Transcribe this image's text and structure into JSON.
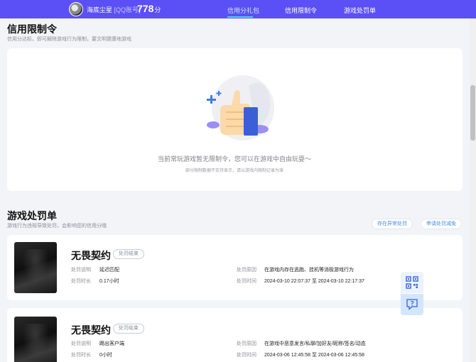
{
  "header": {
    "nickname": "海底尘星",
    "account_type": "[QQ账号]",
    "score_value": "778",
    "score_unit": "分",
    "nav": [
      {
        "label": "信用分礼包",
        "active": true
      },
      {
        "label": "信用限制令",
        "active": false
      },
      {
        "label": "游戏处罚单",
        "active": false
      }
    ]
  },
  "restriction": {
    "title": "信用限制令",
    "subtitle": "信用分达标，即可解除游戏行为限制，要文明健康地游戏",
    "empty_message": "当前常玩游戏暂无限制令，您可以在游戏中自由玩耍～",
    "empty_note": "部分限制数据不支持显示，请以游戏内限制记录为准"
  },
  "punishment": {
    "title": "游戏处罚单",
    "subtitle": "游戏行为违规导致处罚，会影响您的信用分哦",
    "buttons": [
      "存在异常处罚",
      "申请处罚减免"
    ],
    "labels": {
      "explain": "处罚说明",
      "duration": "处罚时长",
      "reason": "处罚原因",
      "time": "处罚时间"
    },
    "items": [
      {
        "game": "无畏契约",
        "status": "处罚结束",
        "explain": "延迟匹配",
        "duration": "0.17小时",
        "reason": "在游戏内存在逃跑、挂机等消极游戏行为",
        "time": "2024-03-10 22:07:37 至 2024-03-10 22:17:37"
      },
      {
        "game": "无畏契约",
        "status": "处罚结束",
        "explain": "踢出客户端",
        "duration": "0小时",
        "reason": "在游戏中恶意发言/私聊/加好友/昵称/签名/动态",
        "time": "2024-03-06 12:45:58 至 2024-03-06 12:45:58"
      }
    ]
  },
  "icons": {
    "qr": "qr-code-icon",
    "feedback": "feedback-icon"
  },
  "colors": {
    "topbar": "#5b50f5",
    "accent_link": "#3d8be0",
    "nav_active": "#4bd3ff"
  }
}
